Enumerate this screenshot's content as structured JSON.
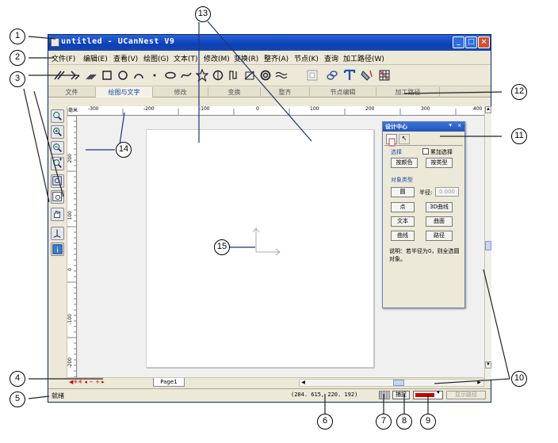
{
  "window": {
    "title": "untitled - UCanNest V9",
    "min_icon": "minimize-icon",
    "max_icon": "maximize-icon",
    "close_icon": "close-icon"
  },
  "menu": [
    "文件(F)",
    "编辑(E)",
    "查看(V)",
    "绘图(G)",
    "文本(T)",
    "修改(M)",
    "变换(R)",
    "整齐(A)",
    "节点(K)",
    "查询",
    "加工路径(W)"
  ],
  "toolbar_icons": [
    "line-tool-icon",
    "arc-tool-icon",
    "multi-line-icon",
    "rectangle-icon",
    "circle-icon",
    "arc-icon",
    "point-icon",
    "ellipse-icon",
    "curve-icon",
    "star-icon",
    "polygon-icon",
    "spiral-icon",
    "bezier-icon",
    "spiral2-icon",
    "wave-icon",
    "frame-icon",
    "link-icon",
    "text-tool-icon",
    "fill-icon",
    "grid-icon"
  ],
  "tabs": [
    "文件",
    "绘图与文字",
    "修改",
    "变换",
    "整齐",
    "节点编辑",
    "加工路径"
  ],
  "left_tools": [
    "zoom-window-icon",
    "zoom-in-icon",
    "zoom-out-icon",
    "zoom-plus-icon",
    "zoom-fit-icon",
    "zoom-page-icon",
    "pan-hand-icon",
    "origin-icon",
    "info-icon"
  ],
  "ruler": {
    "unit": "毫米",
    "h_labels": [
      "-300",
      "-200",
      "-100",
      "0",
      "100",
      "200",
      "300",
      "400"
    ],
    "v_labels": [
      "200",
      "100",
      "0",
      "-100",
      "-200"
    ]
  },
  "page_tab": "Page1",
  "status": {
    "ready": "就绪",
    "coords": "(284. 615,  220. 192)",
    "snap": "捕捉",
    "show_path": "显示路径",
    "color": "#d00000"
  },
  "panel": {
    "title": "设计中心",
    "select_section": "选择",
    "add_select": "累加选择",
    "by_color": "按颜色",
    "by_type": "按类型",
    "object_type": "对象类型",
    "circle": "圆",
    "radius_label": "半径:",
    "radius_value": "0.000",
    "point": "点",
    "curve3d": "3D曲线",
    "text": "文本",
    "surface": "曲面",
    "curve": "曲线",
    "path": "路径",
    "note": "说明：若半径为0，则全选圆对象。"
  },
  "callouts": [
    "1",
    "2",
    "3",
    "4",
    "5",
    "6",
    "7",
    "8",
    "9",
    "10",
    "11",
    "12",
    "13",
    "14",
    "15"
  ]
}
